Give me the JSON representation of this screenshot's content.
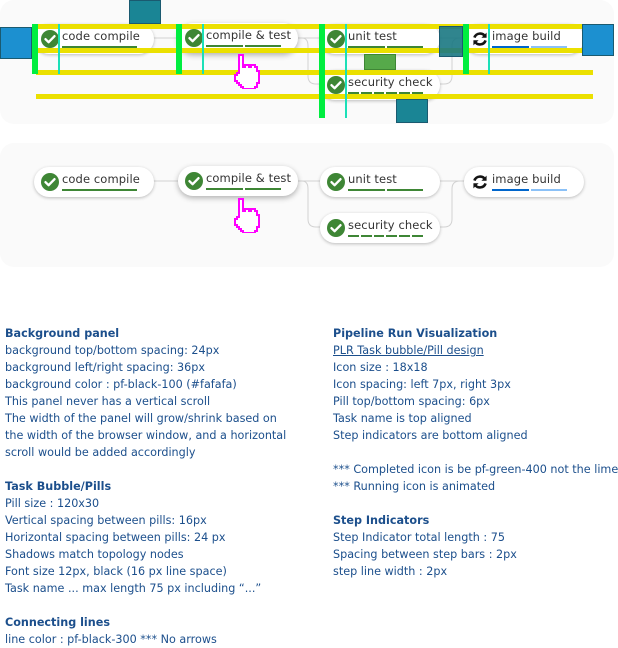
{
  "pipeline": {
    "tasks": [
      {
        "id": "code-compile",
        "name": "code compile",
        "status": "completed",
        "steps": [
          "#3e8635"
        ]
      },
      {
        "id": "compile-test",
        "name": "compile & test",
        "status": "completed",
        "steps": [
          "#3e8635",
          "#3e8635"
        ]
      },
      {
        "id": "unit-test",
        "name": "unit test",
        "status": "completed",
        "steps": [
          "#3e8635",
          "#3e8635"
        ]
      },
      {
        "id": "security-check",
        "name": "security check",
        "status": "completed",
        "steps": [
          "#3e8635",
          "#3e8635",
          "#3e8635",
          "#3e8635",
          "#3e8635",
          "#3e8635"
        ]
      },
      {
        "id": "image-build",
        "name": "image build",
        "status": "running",
        "steps": [
          "#0066cc",
          "#8bc1f7"
        ]
      }
    ],
    "colors": {
      "completed": "#3e8635",
      "running": "#151515",
      "line": "#d2d2d2",
      "panel": "#fafafa",
      "cursor": "#ff00ff"
    }
  },
  "notes": {
    "background_panel": {
      "title": "Background panel",
      "lines": [
        "background top/bottom spacing: 24px",
        "background left/right spacing: 36px",
        "background color : pf-black-100 (#fafafa)",
        "This panel never has a vertical scroll",
        "The width of the panel will grow/shrink based on",
        "the width of the browser window, and a horizontal",
        "scroll would be added accordingly"
      ]
    },
    "task_pills": {
      "title": "Task Bubble/Pills",
      "lines": [
        "Pill size : 120x30",
        "Vertical spacing between pills: 16px",
        "Horizontal spacing between pills: 24 px",
        "Shadows match topology nodes",
        "Font size 12px, black (16 px line space)",
        "Task name ... max length 75 px including “...”"
      ]
    },
    "connecting_lines": {
      "title": "Connecting lines",
      "lines": [
        "line color : pf-black-300 *** No arrows"
      ]
    },
    "plr": {
      "title": "Pipeline Run Visualization",
      "subtitle": "PLR Task bubble/Pill design",
      "lines": [
        "Icon size : 18x18",
        "Icon spacing: left 7px, right 3px",
        "Pill top/bottom spacing: 6px",
        "Task name is top aligned",
        "Step indicators are bottom aligned"
      ],
      "remarks": [
        "*** Completed icon is be pf-green-400 not the lime",
        "*** Running icon is animated"
      ]
    },
    "step_indicators": {
      "title": "Step Indicators",
      "lines": [
        "Step Indicator total length : 75",
        "Spacing between step bars : 2px",
        "step line width : 2px"
      ]
    }
  }
}
